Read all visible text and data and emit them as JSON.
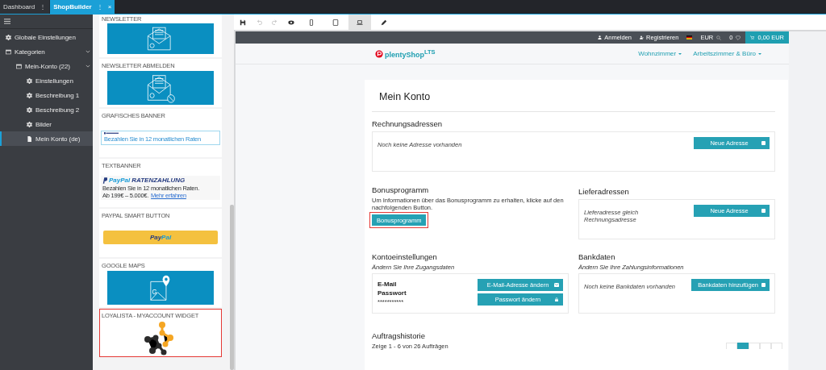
{
  "tabs": [
    {
      "label": "Dashboard",
      "menu": "⋮",
      "selected": false
    },
    {
      "label": "ShopBuilder",
      "menu": "⋮",
      "close": "×",
      "selected": true
    }
  ],
  "sidebar": {
    "items": [
      {
        "label": "Globale Einstellungen",
        "kind": "gear",
        "selected": false
      },
      {
        "label": "Kategorien",
        "kind": "window",
        "expanded": true,
        "selected": false,
        "children": [
          {
            "label": "Mein-Konto (22)",
            "kind": "window",
            "expanded": true,
            "selected": false,
            "children": [
              {
                "label": "Einstellungen",
                "kind": "gear",
                "selected": false
              },
              {
                "label": "Beschreibung 1",
                "kind": "gear",
                "selected": false
              },
              {
                "label": "Beschreibung 2",
                "kind": "gear",
                "selected": false
              },
              {
                "label": "Bilder",
                "kind": "gear",
                "selected": false
              },
              {
                "label": "Mein Konto (de)",
                "kind": "page",
                "selected": true
              }
            ]
          }
        ]
      }
    ]
  },
  "widgets": [
    {
      "label": "NEWSLETTER",
      "kind": "newsletter",
      "highlighted": false
    },
    {
      "label": "NEWSLETTER ABMELDEN",
      "kind": "newsletter-off",
      "highlighted": false
    },
    {
      "label": "GRAFISCHES BANNER",
      "kind": "banner",
      "text": "Bezahlen Sie in 12 monatlichen Raten",
      "highlighted": false
    },
    {
      "label": "TEXTBANNER",
      "kind": "textbanner",
      "brand": "PayPal",
      "title": "RATENZAHLUNG",
      "line1": "Bezahlen Sie in 12 monatlichen Raten.",
      "line2": "Ab 199€ – 5.000€.",
      "link": "Mehr erfahren",
      "highlighted": false
    },
    {
      "label": "PAYPAL SMART BUTTON",
      "kind": "paypal",
      "parts": [
        "Pay",
        "Pal"
      ],
      "highlighted": false
    },
    {
      "label": "GOOGLE MAPS",
      "kind": "maps",
      "letter": "G",
      "highlighted": false
    },
    {
      "label": "LOYALISTA - MYACCOUNT WIDGET",
      "kind": "loyalista",
      "highlighted": true
    }
  ],
  "toolbar": [
    {
      "kind": "save",
      "disabled": false,
      "selected": false
    },
    {
      "kind": "undo",
      "disabled": true,
      "selected": false
    },
    {
      "kind": "redo",
      "disabled": true,
      "selected": false
    },
    {
      "kind": "preview",
      "disabled": false,
      "selected": false
    },
    {
      "kind": "phone",
      "disabled": false,
      "selected": false
    },
    {
      "kind": "tablet",
      "disabled": false,
      "selected": false
    },
    {
      "kind": "desktop",
      "disabled": false,
      "selected": true
    },
    {
      "kind": "pen",
      "disabled": false,
      "selected": false
    }
  ],
  "shop": {
    "topbar": {
      "login": "Anmelden",
      "register": "Registrieren",
      "currency": "EUR",
      "wish_count": "0",
      "cart": "0,00 EUR"
    },
    "header": {
      "logo": "plentyShop",
      "logo_sup": "LTS",
      "nav": [
        "Wohnzimmer",
        "Arbeitszimmer & Büro"
      ]
    }
  },
  "account": {
    "title": "Mein Konto",
    "billing": {
      "heading": "Rechnungsadressen",
      "empty": "Noch keine Adresse vorhanden",
      "button": "Neue Adresse"
    },
    "bonus": {
      "heading": "Bonusprogramm",
      "text": "Um Informationen über das Bonusprogramm zu erhalten, klicke auf den nachfolgenden Button.",
      "button": "Bonusprogramm",
      "highlighted": true
    },
    "delivery": {
      "heading": "Lieferadressen",
      "empty": "Lieferadresse gleich Rechnungsadresse",
      "button": "Neue Adresse"
    },
    "settings": {
      "heading": "Kontoeinstellungen",
      "subtitle": "Ändern Sie Ihre Zugangsdaten",
      "email_label": "E-Mail",
      "password_label": "Passwort",
      "password_value": "***********",
      "email_button": "E-Mail-Adresse ändern",
      "password_button": "Passwort ändern"
    },
    "bank": {
      "heading": "Bankdaten",
      "subtitle": "Ändern Sie Ihre Zahlungsinformationen",
      "empty": "Noch keine Bankdaten vorhanden",
      "button": "Bankdaten hinzufügen"
    },
    "orders": {
      "heading": "Auftragshistorie",
      "summary": "Zeige 1 - 6 von 26 Aufträgen",
      "pages": [
        {
          "selected": false
        },
        {
          "selected": true
        },
        {
          "selected": false
        },
        {
          "selected": false
        },
        {
          "selected": false
        }
      ]
    }
  }
}
